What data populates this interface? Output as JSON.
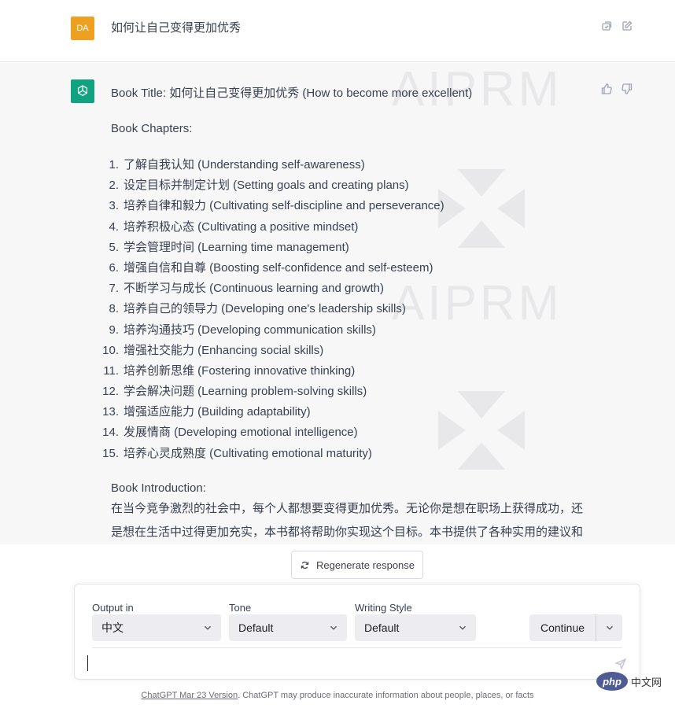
{
  "user_message": {
    "avatar_text": "DA",
    "text": "如何让自己变得更加优秀"
  },
  "assistant_message": {
    "book_title_line": "Book Title: 如何让自己变得更加优秀 (How to become more excellent)",
    "chapters_heading": "Book Chapters:",
    "chapters": [
      {
        "num": "1.",
        "text": "了解自我认知 (Understanding self-awareness)"
      },
      {
        "num": "2.",
        "text": "设定目标并制定计划 (Setting goals and creating plans)"
      },
      {
        "num": "3.",
        "text": "培养自律和毅力 (Cultivating self-discipline and perseverance)"
      },
      {
        "num": "4.",
        "text": "培养积极心态 (Cultivating a positive mindset)"
      },
      {
        "num": "5.",
        "text": "学会管理时间 (Learning time management)"
      },
      {
        "num": "6.",
        "text": "增强自信和自尊 (Boosting self-confidence and self-esteem)"
      },
      {
        "num": "7.",
        "text": "不断学习与成长 (Continuous learning and growth)"
      },
      {
        "num": "8.",
        "text": "培养自己的领导力 (Developing one's leadership skills)"
      },
      {
        "num": "9.",
        "text": "培养沟通技巧 (Developing communication skills)"
      },
      {
        "num": "10.",
        "text": "增强社交能力 (Enhancing social skills)"
      },
      {
        "num": "11.",
        "text": "培养创新思维 (Fostering innovative thinking)"
      },
      {
        "num": "12.",
        "text": "学会解决问题 (Learning problem-solving skills)"
      },
      {
        "num": "13.",
        "text": "增强适应能力 (Building adaptability)"
      },
      {
        "num": "14.",
        "text": "发展情商 (Developing emotional intelligence)"
      },
      {
        "num": "15.",
        "text": "培养心灵成熟度 (Cultivating emotional maturity)"
      }
    ],
    "intro_heading": "Book Introduction:",
    "intro_line1": "在当今竞争激烈的社会中，每个人都想要变得更加优秀。无论你是想在职场上获得成功，还",
    "intro_line2": "是想在生活中过得更加充实，本书都将帮助你实现这个目标。本书提供了各种实用的建议和"
  },
  "watermark": {
    "text1": "AIPRM",
    "text2": "AIPRM"
  },
  "regenerate_label": "Regenerate response",
  "prompt_panel": {
    "output_label": "Output in",
    "output_value": "中文",
    "tone_label": "Tone",
    "tone_value": "Default",
    "style_label": "Writing Style",
    "style_value": "Default",
    "continue_label": "Continue"
  },
  "footer": {
    "link_text": "ChatGPT Mar 23 Version",
    "rest_text": ". ChatGPT may produce inaccurate information about people, places, or facts"
  },
  "badge": {
    "pill": "php",
    "text": "中文网"
  },
  "colors": {
    "gpt_green": "#10a37f",
    "avatar_orange": "#f0a020",
    "assistant_bg": "#f7f7f8"
  }
}
